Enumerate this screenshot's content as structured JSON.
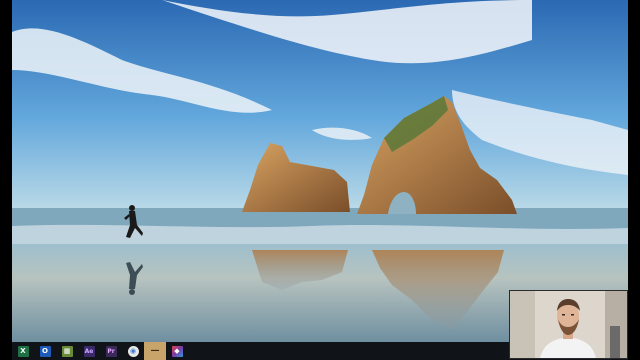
{
  "wallpaper": {
    "description_icon": "windows-10-hero-beach-wallpaper",
    "colors": {
      "sky_top": "#2f6fb8",
      "sky_mid": "#5aa0d8",
      "sea": "#8fb7c9",
      "sand": "#c8a474",
      "rock": "#c0884c"
    }
  },
  "taskbar": {
    "background": "#101318",
    "items": [
      {
        "name": "excel-icon",
        "glyph": "X",
        "color": "#1e7145",
        "active": false
      },
      {
        "name": "outlook-icon",
        "glyph": "O",
        "color": "#1e5bb8",
        "active": false
      },
      {
        "name": "app-icon",
        "glyph": "▦",
        "color": "#6a8a3a",
        "active": false
      },
      {
        "name": "after-effects-icon",
        "glyph": "Ae",
        "color": "#3b2a6b",
        "active": false
      },
      {
        "name": "premiere-icon",
        "glyph": "Pr",
        "color": "#3a2a5a",
        "active": false
      },
      {
        "name": "chrome-icon",
        "glyph": "◉",
        "color": "#3e7bd6",
        "active": false
      },
      {
        "name": "minimize-icon",
        "glyph": "—",
        "color": "#c8a46a",
        "active": true
      },
      {
        "name": "colorful-app-icon",
        "glyph": "◆",
        "color": "#7a3aa8",
        "active": false
      }
    ]
  },
  "webcam": {
    "present": true
  }
}
